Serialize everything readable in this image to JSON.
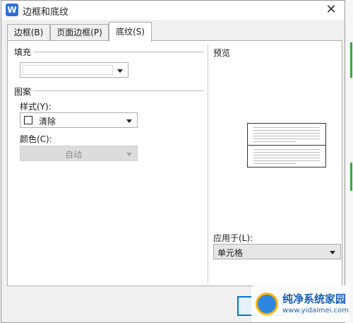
{
  "dialog": {
    "title": "边框和底纹",
    "app_icon_letter": "W",
    "close_glyph": "✕"
  },
  "tabs": [
    {
      "label": "边框(B)",
      "active": false
    },
    {
      "label": "页面边框(P)",
      "active": false
    },
    {
      "label": "底纹(S)",
      "active": true
    }
  ],
  "fill": {
    "label": "填充",
    "value": ""
  },
  "pattern": {
    "label": "图案",
    "style_label": "样式(Y):",
    "style_value": "清除",
    "color_label": "颜色(C):",
    "color_value": "自动"
  },
  "preview": {
    "label": "预览"
  },
  "apply_to": {
    "label": "应用于(L):",
    "value": "单元格"
  },
  "watermark": {
    "text": "纯净系统家园",
    "url": "www.yidaimei.com"
  },
  "colors": {
    "accent": "#0078d7",
    "app_icon": "#2f6fd8",
    "watermark": "#1a5fb4"
  }
}
